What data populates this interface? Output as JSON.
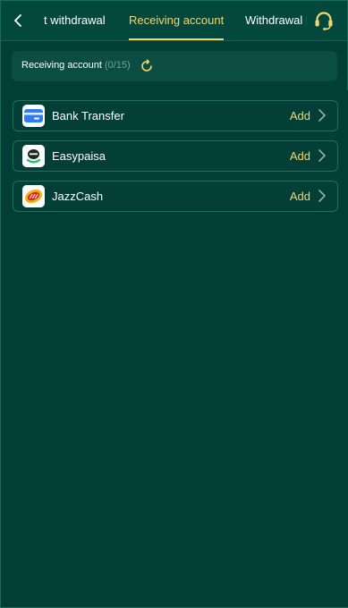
{
  "header": {
    "tabs": [
      {
        "label": "t withdrawal"
      },
      {
        "label": "Receiving account"
      },
      {
        "label": "Withdrawal Records"
      }
    ]
  },
  "account_bar": {
    "label": "Receiving account",
    "count": "(0/15)"
  },
  "methods": [
    {
      "name": "Bank Transfer",
      "action": "Add",
      "icon": "bank-card-icon"
    },
    {
      "name": "Easypaisa",
      "action": "Add",
      "icon": "easypaisa-logo"
    },
    {
      "name": "JazzCash",
      "action": "Add",
      "icon": "jazzcash-logo"
    }
  ],
  "colors": {
    "background": "#013e36",
    "accent": "#f5d66e",
    "muted": "#6aa797"
  }
}
